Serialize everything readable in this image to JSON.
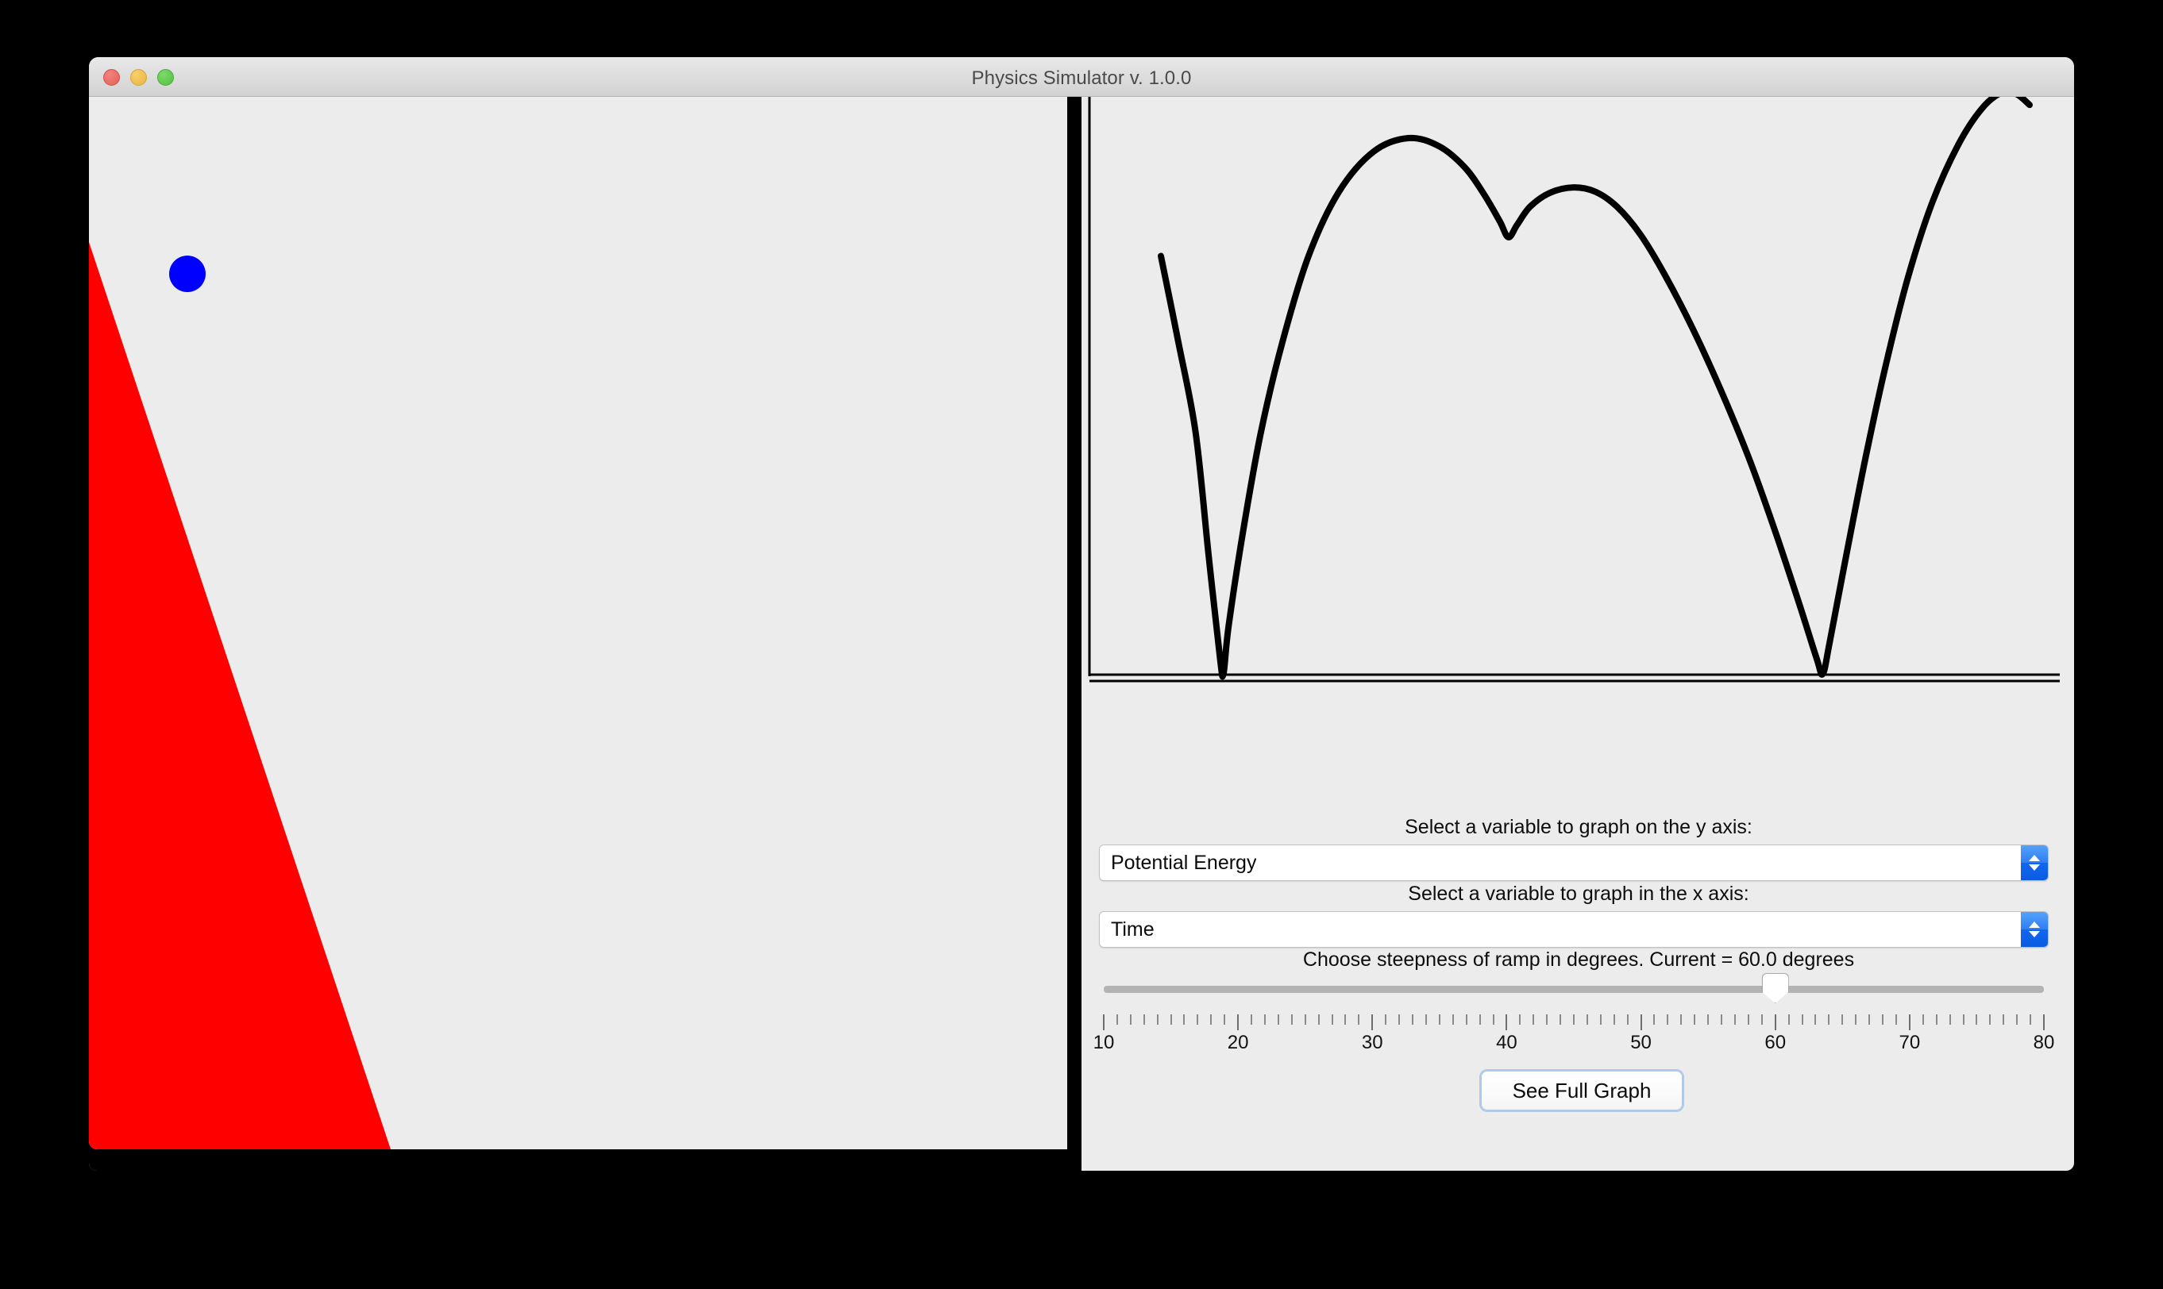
{
  "window": {
    "title": "Physics Simulator v. 1.0.0",
    "traffic_lights": {
      "close": "close-button",
      "minimize": "minimize-button",
      "zoom": "zoom-button"
    }
  },
  "simulation": {
    "ramp": {
      "color": "#FF0000",
      "shape": "right-triangle",
      "steepness_degrees": 60.0
    },
    "ball": {
      "color": "#0000FF",
      "radius_px": 23
    },
    "background": "#ECECEC"
  },
  "controls": {
    "y_axis_label": "Select a variable to graph on the y axis:",
    "y_axis_value": "Potential Energy",
    "x_axis_label": "Select a variable to graph in the x axis:",
    "x_axis_value": "Time",
    "slider_label": "Choose steepness of ramp in degrees. Current = 60.0 degrees",
    "slider": {
      "min": 10,
      "max": 80,
      "value": 60,
      "tick_labels": [
        "10",
        "20",
        "30",
        "40",
        "50",
        "60",
        "70",
        "80"
      ],
      "minor_tick_step": 1
    },
    "button_label": "See Full Graph"
  },
  "chart_data": {
    "type": "line",
    "title": "",
    "xlabel": "Time",
    "ylabel": "Potential Energy",
    "grid": false,
    "legend": null,
    "axes": {
      "x_axis_visible": true,
      "y_axis_visible": true,
      "x_axis_style": "double-line",
      "tick_labels_shown": false
    },
    "line_color": "#000000",
    "line_width": 8,
    "series": [
      {
        "name": "Potential Energy",
        "points": [
          [
            0.0,
            0.78
          ],
          [
            0.02,
            0.62
          ],
          [
            0.04,
            0.45
          ],
          [
            0.055,
            0.22
          ],
          [
            0.068,
            0.03
          ],
          [
            0.072,
            0.0
          ],
          [
            0.078,
            0.09
          ],
          [
            0.095,
            0.27
          ],
          [
            0.115,
            0.45
          ],
          [
            0.14,
            0.62
          ],
          [
            0.17,
            0.78
          ],
          [
            0.205,
            0.9
          ],
          [
            0.245,
            0.975
          ],
          [
            0.285,
            1.0
          ],
          [
            0.32,
            0.985
          ],
          [
            0.35,
            0.945
          ],
          [
            0.372,
            0.895
          ],
          [
            0.39,
            0.845
          ],
          [
            0.4,
            0.815
          ],
          [
            0.41,
            0.838
          ],
          [
            0.425,
            0.872
          ],
          [
            0.448,
            0.898
          ],
          [
            0.475,
            0.908
          ],
          [
            0.5,
            0.9
          ],
          [
            0.525,
            0.872
          ],
          [
            0.552,
            0.82
          ],
          [
            0.58,
            0.745
          ],
          [
            0.612,
            0.645
          ],
          [
            0.645,
            0.528
          ],
          [
            0.678,
            0.398
          ],
          [
            0.708,
            0.262
          ],
          [
            0.735,
            0.13
          ],
          [
            0.755,
            0.028
          ],
          [
            0.762,
            0.0
          ],
          [
            0.77,
            0.06
          ],
          [
            0.79,
            0.23
          ],
          [
            0.812,
            0.41
          ],
          [
            0.835,
            0.58
          ],
          [
            0.86,
            0.74
          ],
          [
            0.888,
            0.88
          ],
          [
            0.918,
            0.988
          ],
          [
            0.945,
            1.055
          ],
          [
            0.968,
            1.085
          ],
          [
            0.985,
            1.082
          ],
          [
            1.0,
            1.062
          ]
        ]
      }
    ],
    "description": "Potential energy vs time for a ball bouncing on a ramp; two deep V-shaped minima at the ground contacts and arched peaks between bounces."
  }
}
